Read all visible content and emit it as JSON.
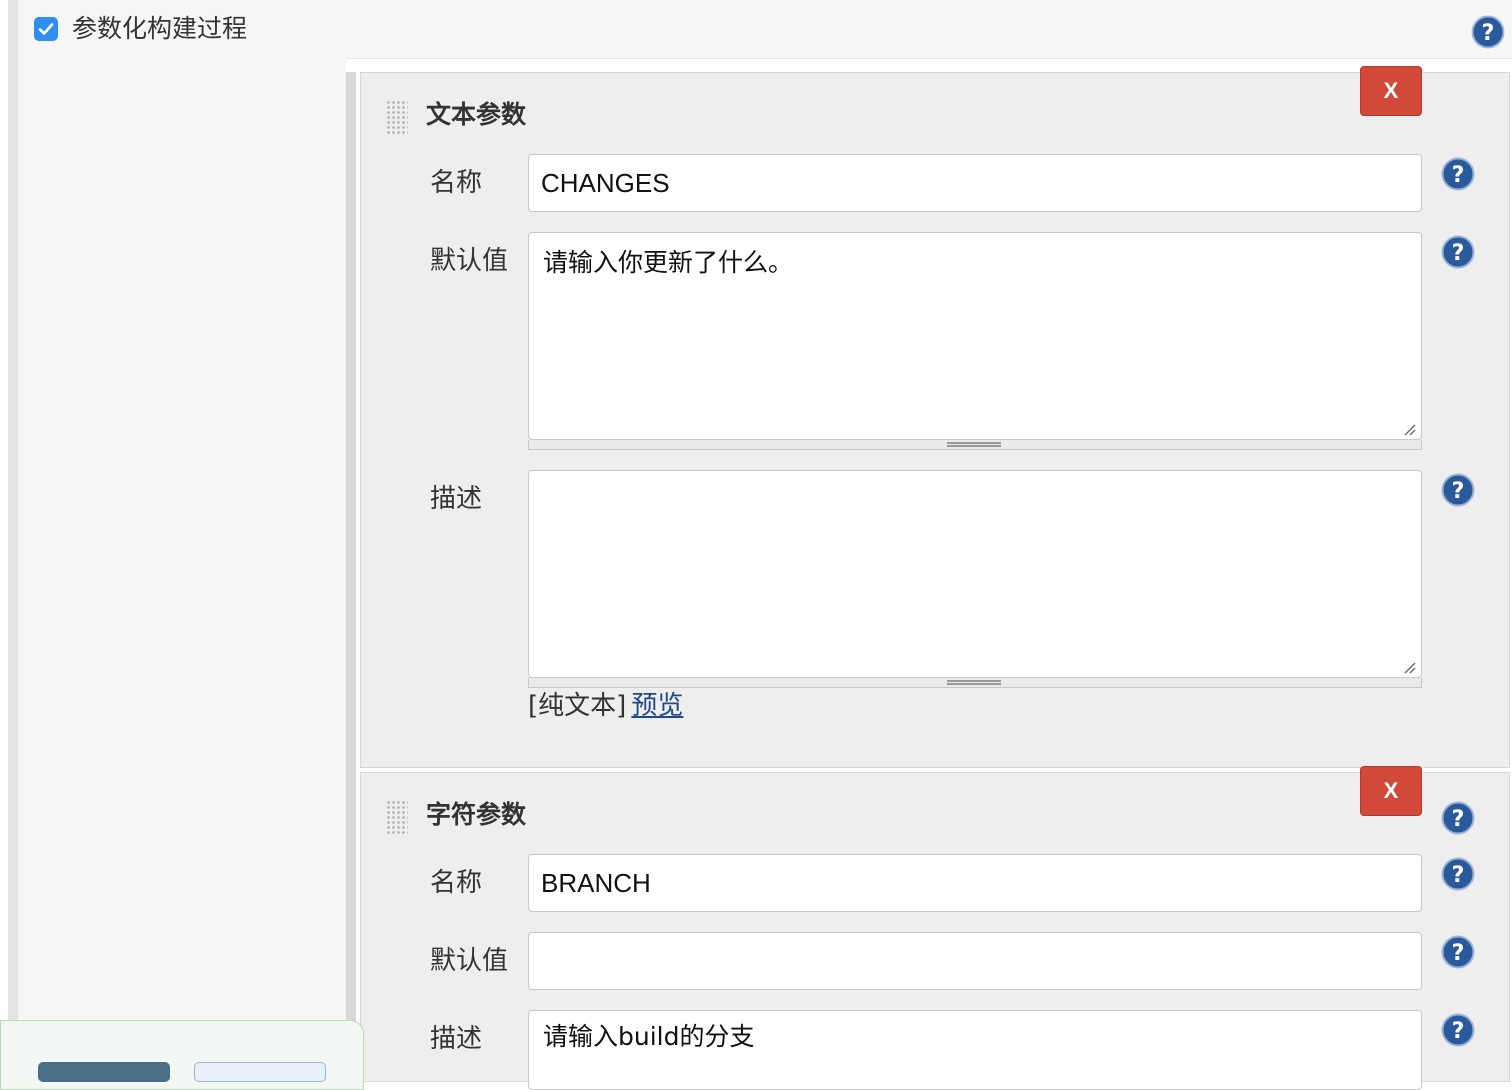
{
  "header": {
    "checkbox_checked": true,
    "label": "参数化构建过程",
    "help_icon": "help-icon"
  },
  "params": [
    {
      "title": "文本参数",
      "delete_label": "X",
      "name_label": "名称",
      "name_value": "CHANGES",
      "default_label": "默认值",
      "default_value": "请输入你更新了什么。",
      "desc_label": "描述",
      "desc_value": "",
      "format_label": "[纯文本]",
      "preview_label": "预览"
    },
    {
      "title": "字符参数",
      "delete_label": "X",
      "name_label": "名称",
      "name_value": "BRANCH",
      "default_label": "默认值",
      "default_value": "",
      "desc_label": "描述",
      "desc_value": "请输入build的分支"
    }
  ],
  "colors": {
    "accent_checkbox": "#2f8ff0",
    "delete_button": "#d24939",
    "help_icon": "#2a5a9c",
    "link": "#204a87"
  }
}
